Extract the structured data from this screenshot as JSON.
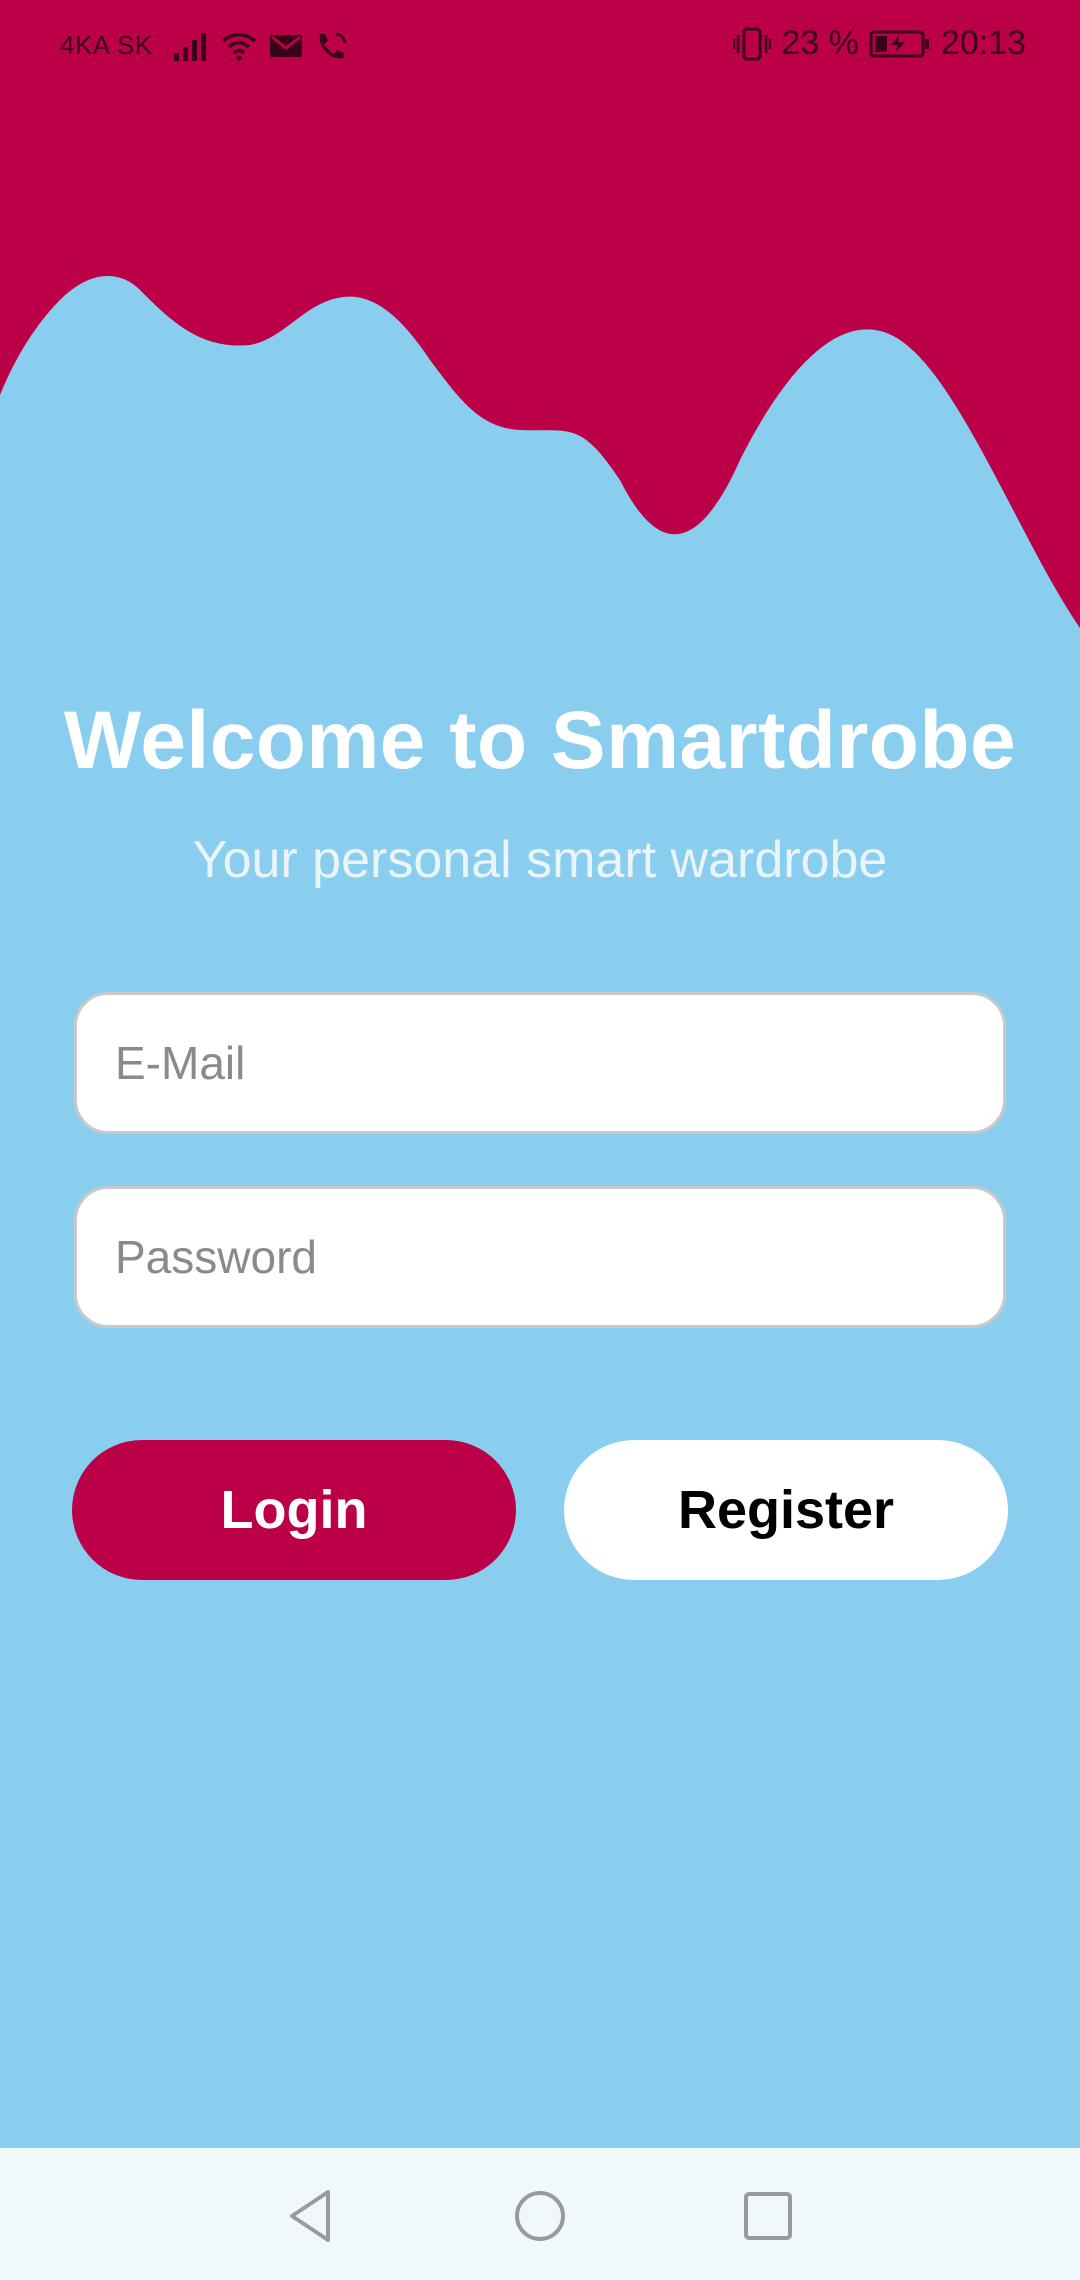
{
  "status_bar": {
    "carrier": "4KA SK",
    "battery_percent": "23 %",
    "time": "20:13",
    "icons": [
      "signal-icon",
      "wifi-icon",
      "mail-icon",
      "call-icon",
      "vibrate-icon",
      "battery-charging-icon"
    ]
  },
  "header": {
    "title": "Welcome to Smartdrobe",
    "subtitle": "Your personal smart wardrobe"
  },
  "form": {
    "email": {
      "value": "",
      "placeholder": "E-Mail"
    },
    "password": {
      "value": "",
      "placeholder": "Password"
    }
  },
  "actions": {
    "login_label": "Login",
    "register_label": "Register"
  },
  "navigation": {
    "icons": [
      "back-icon",
      "home-icon",
      "recents-icon"
    ]
  },
  "colors": {
    "primary": "#BC0048",
    "background": "#8ACEEF",
    "surface": "#FFFFFF",
    "navbar": "#F1F8FC"
  }
}
